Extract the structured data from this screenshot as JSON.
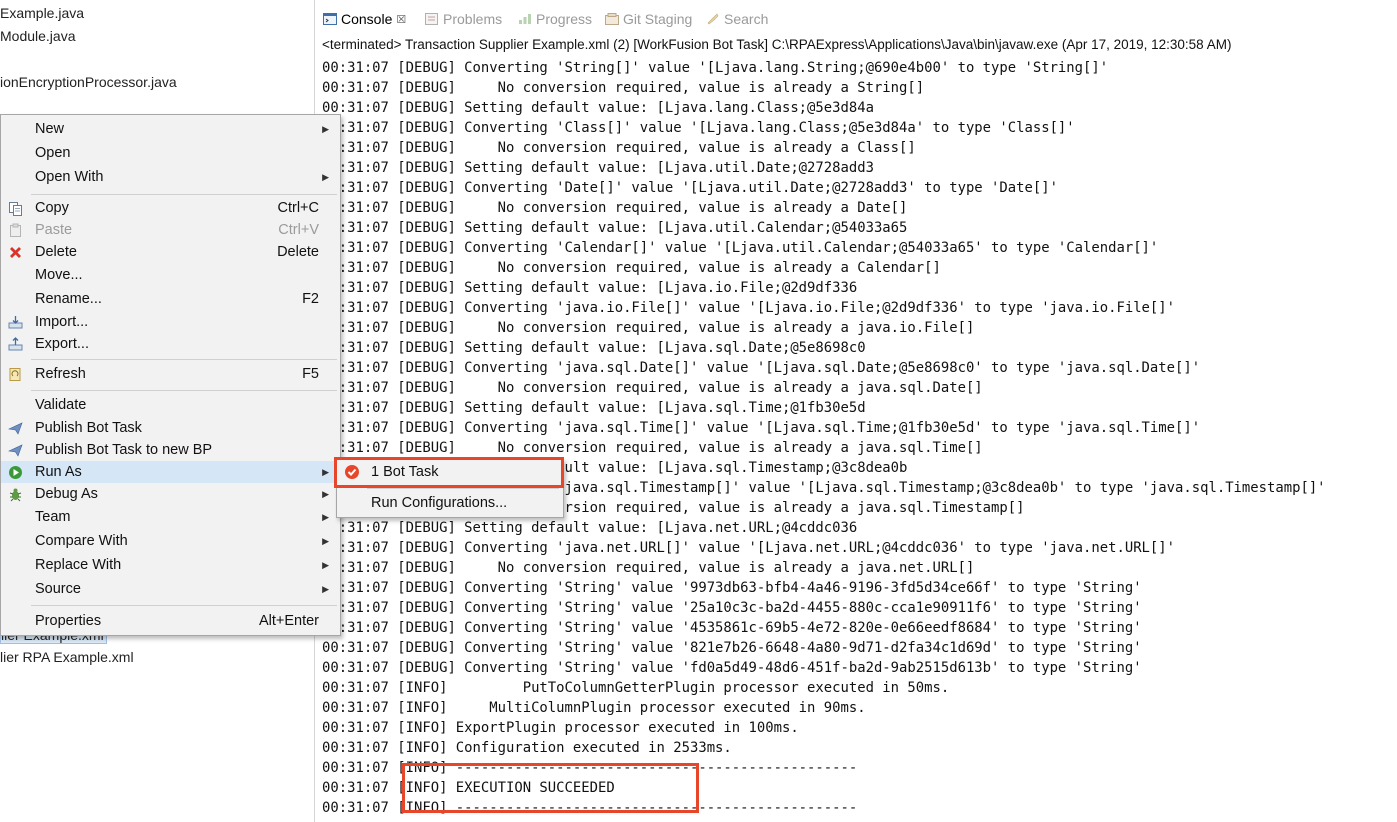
{
  "explorer": {
    "files": [
      "Example.java",
      "Module.java",
      "ionEncryptionProcessor.java",
      "lier Example.xml",
      "lier RPA Example.xml"
    ]
  },
  "console": {
    "tabs": [
      {
        "label": "Console",
        "icon": "console-icon",
        "active": true,
        "close": "☒"
      },
      {
        "label": "Problems",
        "icon": "problems-icon",
        "active": false
      },
      {
        "label": "Progress",
        "icon": "progress-icon",
        "active": false
      },
      {
        "label": "Git Staging",
        "icon": "git-staging-icon",
        "active": false
      },
      {
        "label": "Search",
        "icon": "search-icon",
        "active": false
      }
    ],
    "status": "<terminated> Transaction Supplier Example.xml (2) [WorkFusion Bot Task] C:\\RPAExpress\\Applications\\Java\\bin\\javaw.exe (Apr 17, 2019, 12:30:58 AM)",
    "lines": [
      "00:31:07 [DEBUG] Converting 'String[]' value '[Ljava.lang.String;@690e4b00' to type 'String[]'",
      "00:31:07 [DEBUG]     No conversion required, value is already a String[]",
      "00:31:07 [DEBUG] Setting default value: [Ljava.lang.Class;@5e3d84a",
      "00:31:07 [DEBUG] Converting 'Class[]' value '[Ljava.lang.Class;@5e3d84a' to type 'Class[]'",
      "00:31:07 [DEBUG]     No conversion required, value is already a Class[]",
      "00:31:07 [DEBUG] Setting default value: [Ljava.util.Date;@2728add3",
      "00:31:07 [DEBUG] Converting 'Date[]' value '[Ljava.util.Date;@2728add3' to type 'Date[]'",
      "00:31:07 [DEBUG]     No conversion required, value is already a Date[]",
      "00:31:07 [DEBUG] Setting default value: [Ljava.util.Calendar;@54033a65",
      "00:31:07 [DEBUG] Converting 'Calendar[]' value '[Ljava.util.Calendar;@54033a65' to type 'Calendar[]'",
      "00:31:07 [DEBUG]     No conversion required, value is already a Calendar[]",
      "00:31:07 [DEBUG] Setting default value: [Ljava.io.File;@2d9df336",
      "00:31:07 [DEBUG] Converting 'java.io.File[]' value '[Ljava.io.File;@2d9df336' to type 'java.io.File[]'",
      "00:31:07 [DEBUG]     No conversion required, value is already a java.io.File[]",
      "00:31:07 [DEBUG] Setting default value: [Ljava.sql.Date;@5e8698c0",
      "00:31:07 [DEBUG] Converting 'java.sql.Date[]' value '[Ljava.sql.Date;@5e8698c0' to type 'java.sql.Date[]'",
      "00:31:07 [DEBUG]     No conversion required, value is already a java.sql.Date[]",
      "00:31:07 [DEBUG] Setting default value: [Ljava.sql.Time;@1fb30e5d",
      "00:31:07 [DEBUG] Converting 'java.sql.Time[]' value '[Ljava.sql.Time;@1fb30e5d' to type 'java.sql.Time[]'",
      "00:31:07 [DEBUG]     No conversion required, value is already a java.sql.Time[]",
      "00:31:07 [DEBUG] Setting default value: [Ljava.sql.Timestamp;@3c8dea0b",
      "00:31:07 [DEBUG] Converting 'java.sql.Timestamp[]' value '[Ljava.sql.Timestamp;@3c8dea0b' to type 'java.sql.Timestamp[]'",
      "00:31:07 [DEBUG]     No conversion required, value is already a java.sql.Timestamp[]",
      "00:31:07 [DEBUG] Setting default value: [Ljava.net.URL;@4cddc036",
      "00:31:07 [DEBUG] Converting 'java.net.URL[]' value '[Ljava.net.URL;@4cddc036' to type 'java.net.URL[]'",
      "00:31:07 [DEBUG]     No conversion required, value is already a java.net.URL[]",
      "00:31:07 [DEBUG] Converting 'String' value '9973db63-bfb4-4a46-9196-3fd5d34ce66f' to type 'String'",
      "00:31:07 [DEBUG] Converting 'String' value '25a10c3c-ba2d-4455-880c-cca1e90911f6' to type 'String'",
      "00:31:07 [DEBUG] Converting 'String' value '4535861c-69b5-4e72-820e-0e66eedf8684' to type 'String'",
      "00:31:07 [DEBUG] Converting 'String' value '821e7b26-6648-4a80-9d71-d2fa34c1d69d' to type 'String'",
      "00:31:07 [DEBUG] Converting 'String' value 'fd0a5d49-48d6-451f-ba2d-9ab2515d613b' to type 'String'",
      "00:31:07 [INFO]         PutToColumnGetterPlugin processor executed in 50ms.",
      "00:31:07 [INFO]     MultiColumnPlugin processor executed in 90ms.",
      "00:31:07 [INFO] ExportPlugin processor executed in 100ms.",
      "00:31:07 [INFO] Configuration executed in 2533ms.",
      "00:31:07 [INFO] ------------------------------------------------",
      "00:31:07 [INFO] EXECUTION SUCCEEDED",
      "00:31:07 [INFO] ------------------------------------------------"
    ]
  },
  "context_menu": {
    "items": [
      {
        "label": "New",
        "submenu": true
      },
      {
        "label": "Open"
      },
      {
        "label": "Open With",
        "submenu": true
      },
      {
        "sep": true
      },
      {
        "label": "Copy",
        "accel": "Ctrl+C",
        "icon": "copy-icon"
      },
      {
        "label": "Paste",
        "accel": "Ctrl+V",
        "icon": "paste-icon",
        "disabled": true
      },
      {
        "label": "Delete",
        "accel": "Delete",
        "icon": "delete-icon"
      },
      {
        "label": "Move..."
      },
      {
        "label": "Rename...",
        "accel": "F2"
      },
      {
        "label": "Import...",
        "icon": "import-icon"
      },
      {
        "label": "Export...",
        "icon": "export-icon"
      },
      {
        "sep": true
      },
      {
        "label": "Refresh",
        "accel": "F5",
        "icon": "refresh-icon"
      },
      {
        "sep": true
      },
      {
        "label": "Validate"
      },
      {
        "label": "Publish Bot Task",
        "icon": "publish-icon"
      },
      {
        "label": "Publish Bot Task to new BP",
        "icon": "publish-icon"
      },
      {
        "label": "Run As",
        "submenu": true,
        "icon": "run-icon",
        "hover": true
      },
      {
        "label": "Debug As",
        "submenu": true,
        "icon": "debug-icon"
      },
      {
        "label": "Team",
        "submenu": true
      },
      {
        "label": "Compare With",
        "submenu": true
      },
      {
        "label": "Replace With",
        "submenu": true
      },
      {
        "label": "Source",
        "submenu": true
      },
      {
        "sep": true
      },
      {
        "label": "Properties",
        "accel": "Alt+Enter"
      }
    ],
    "submenu": {
      "items": [
        {
          "label": "1 Bot Task",
          "icon": "bot-task-icon"
        },
        {
          "sep": true
        },
        {
          "label": "Run Configurations..."
        }
      ]
    }
  },
  "colors": {
    "highlight": "#e8462b",
    "menu_bg": "#f2f2f2",
    "menu_hover": "#d5e6f7"
  }
}
